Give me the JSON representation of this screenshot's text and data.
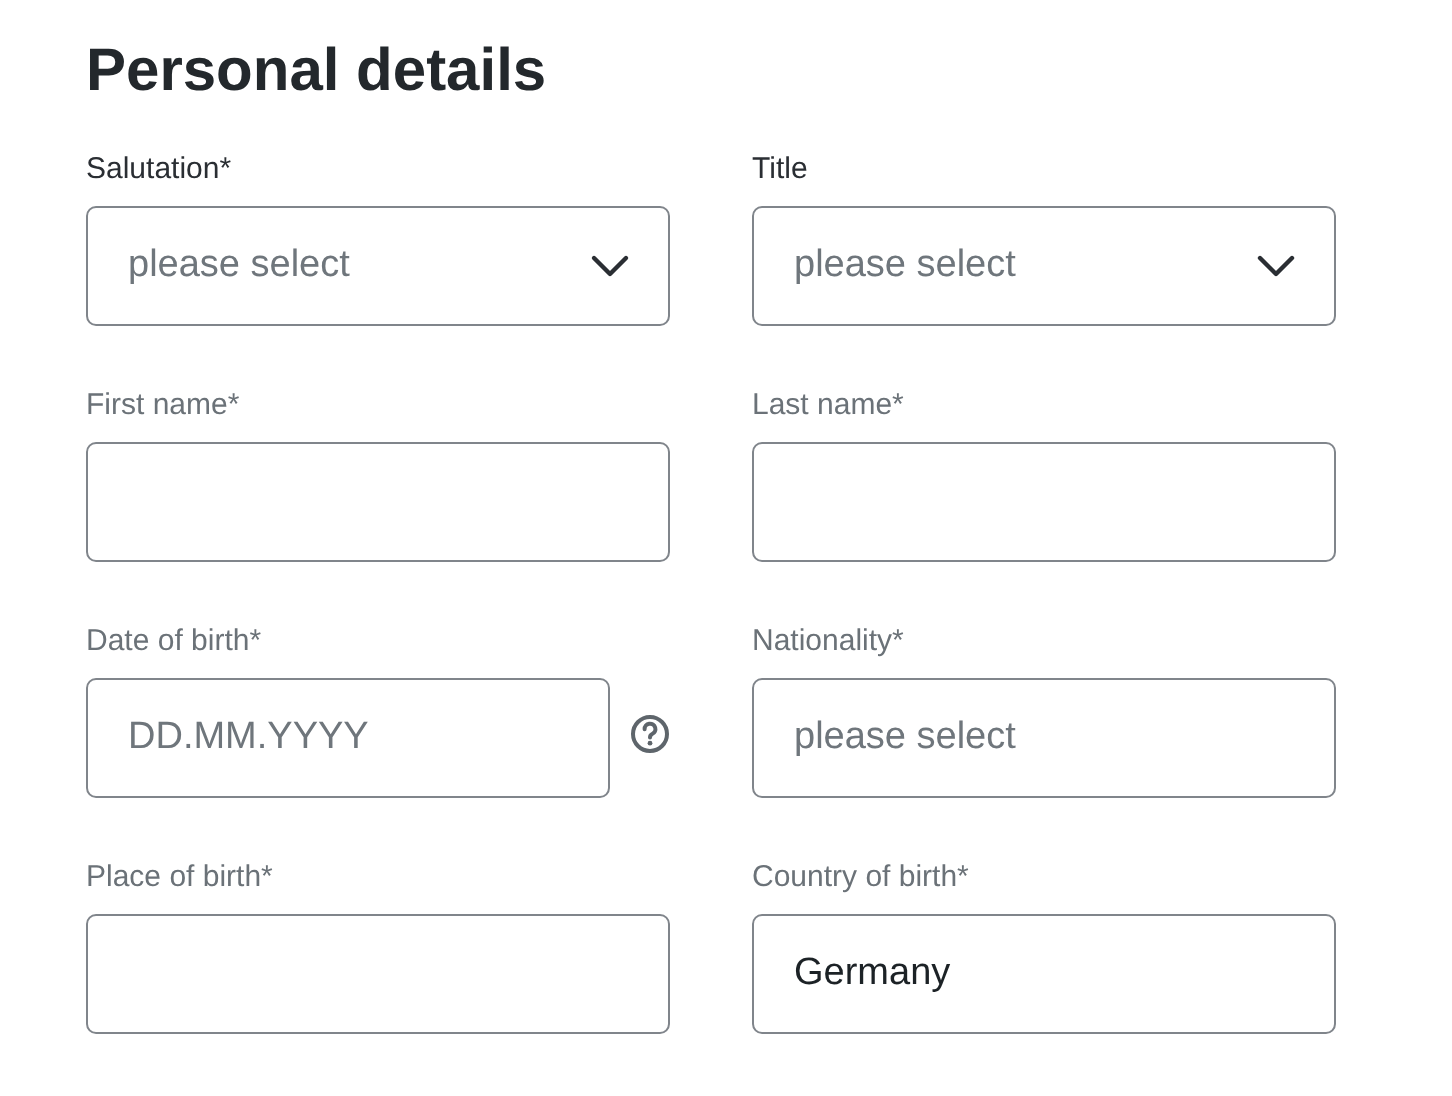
{
  "heading": "Personal details",
  "fields": [
    {
      "label": "Salutation*",
      "highlighted": true,
      "kind": "dropdown",
      "placeholder": "please select",
      "help": false
    },
    {
      "label": "Title",
      "highlighted": true,
      "kind": "dropdown",
      "placeholder": "please select",
      "help": false
    },
    {
      "label": "First name*",
      "highlighted": false,
      "kind": "text",
      "help": false
    },
    {
      "label": "Last name*",
      "highlighted": false,
      "kind": "text",
      "help": false
    },
    {
      "label": "Date of birth*",
      "highlighted": false,
      "kind": "text",
      "placeholder": "DD.MM.YYYY",
      "help": true
    },
    {
      "label": "Nationality*",
      "highlighted": false,
      "kind": "text",
      "placeholder": "please select",
      "help": false
    },
    {
      "label": "Place of birth*",
      "highlighted": false,
      "kind": "text",
      "help": false
    },
    {
      "label": "Country of birth*",
      "highlighted": false,
      "kind": "text",
      "value": "Germany",
      "help": false
    }
  ]
}
